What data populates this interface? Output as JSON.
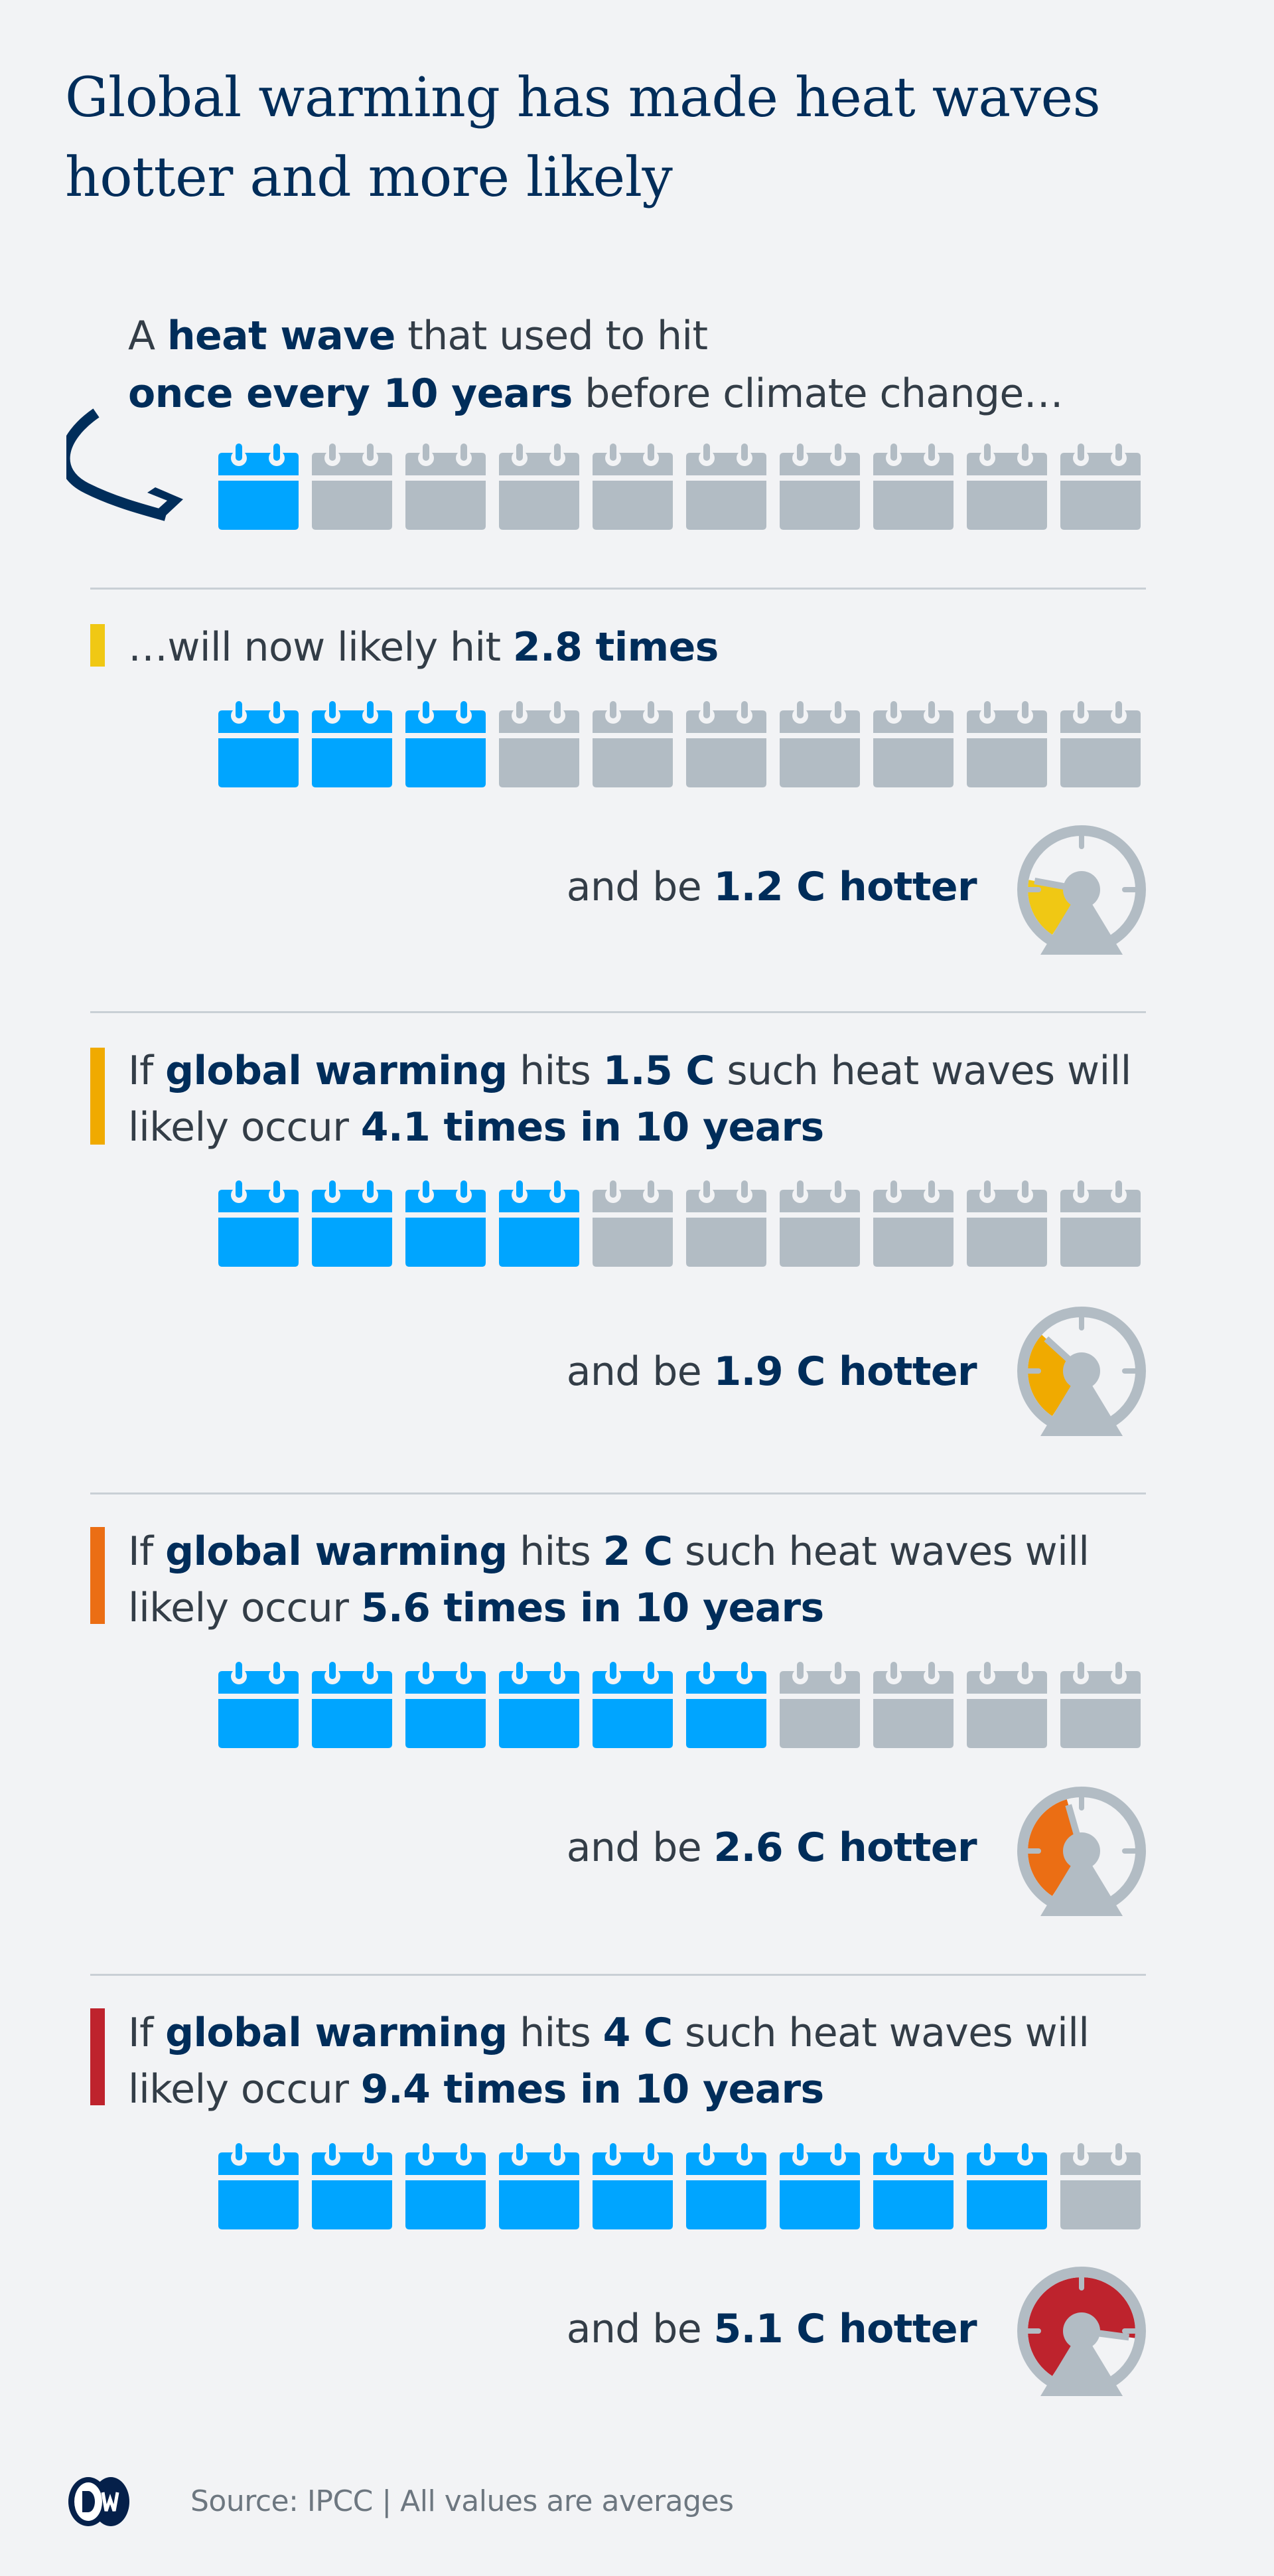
{
  "title": "Global warming has made heat waves hotter and more likely",
  "colors": {
    "background": "#f2f3f5",
    "navy": "#002d5a",
    "calendar_filled": "#00a5ff",
    "calendar_empty": "#b2bcc4",
    "gauge_frame": "#b2bcc4"
  },
  "intro": {
    "line1": [
      "A ",
      "heat wave",
      " that used to hit"
    ],
    "line2": [
      "once every 10 years",
      " before climate change…"
    ],
    "calendars_filled": 1,
    "calendars_total": 10
  },
  "scenarios": [
    {
      "color": "#f0c814",
      "line1": [
        "…will now likely hit ",
        "2.8 times"
      ],
      "calendars_filled": 2.8,
      "hotter": [
        "and be ",
        "1.2 C hotter"
      ],
      "warming_c": 1.2
    },
    {
      "color": "#f0aa00",
      "line1": [
        "If ",
        "global warming",
        " hits ",
        "1.5 C",
        " such heat waves will"
      ],
      "line2": [
        "likely occur ",
        "4.1 times in 10 years"
      ],
      "calendars_filled": 4.1,
      "hotter": [
        "and be ",
        "1.9 C hotter"
      ],
      "warming_c": 1.9
    },
    {
      "color": "#eb6e14",
      "line1": [
        "If ",
        "global warming",
        " hits ",
        "2 C",
        " such heat waves will"
      ],
      "line2": [
        "likely occur ",
        "5.6 times in 10 years"
      ],
      "calendars_filled": 5.6,
      "hotter": [
        "and be ",
        "2.6 C hotter"
      ],
      "warming_c": 2.6
    },
    {
      "color": "#be232d",
      "line1": [
        "If ",
        "global warming",
        " hits ",
        "4 C",
        " such heat waves will"
      ],
      "line2": [
        "likely occur ",
        "9.4 times in 10 years"
      ],
      "calendars_filled": 9.4,
      "hotter": [
        "and be ",
        "5.1 C hotter"
      ],
      "warming_c": 5.1
    }
  ],
  "footer": {
    "logo": "DW",
    "source": "Source: IPCC | All values are averages"
  }
}
